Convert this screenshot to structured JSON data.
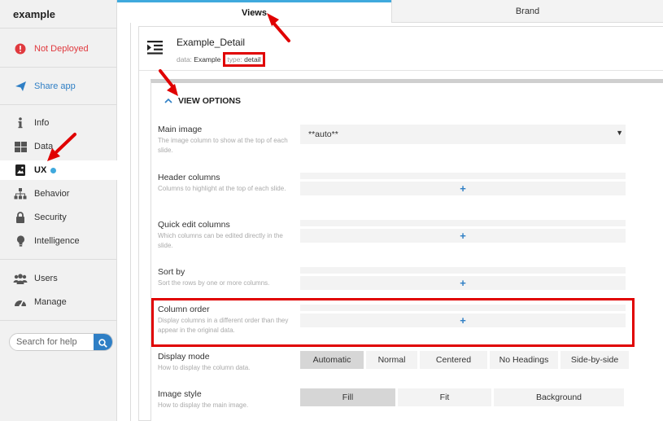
{
  "app": {
    "name": "example"
  },
  "sidebar": {
    "status": {
      "label": "Not Deployed",
      "icon": "alert-circle-icon"
    },
    "share": {
      "label": "Share app",
      "icon": "send-icon"
    },
    "items": [
      {
        "label": "Info",
        "icon": "info-icon"
      },
      {
        "label": "Data",
        "icon": "grid-icon"
      },
      {
        "label": "UX",
        "icon": "ux-icon"
      },
      {
        "label": "Behavior",
        "icon": "sitemap-icon"
      },
      {
        "label": "Security",
        "icon": "lock-icon"
      },
      {
        "label": "Intelligence",
        "icon": "lightbulb-icon"
      }
    ],
    "bottom": [
      {
        "label": "Users",
        "icon": "users-icon"
      },
      {
        "label": "Manage",
        "icon": "gauge-icon"
      }
    ],
    "search": {
      "placeholder": "Search for help"
    }
  },
  "tabs": {
    "views": "Views",
    "brand": "Brand"
  },
  "view": {
    "title": "Example_Detail",
    "data_key": "data:",
    "data_value": "Example",
    "type_key": "type:",
    "type_value": "detail"
  },
  "options": {
    "heading": "VIEW OPTIONS",
    "main_image": {
      "label": "Main image",
      "desc": "The image column to show at the top of each slide.",
      "value": "**auto**"
    },
    "header_columns": {
      "label": "Header columns",
      "desc": "Columns to highlight at the top of each slide.",
      "add": "+"
    },
    "quick_edit": {
      "label": "Quick edit columns",
      "desc": "Which columns can be edited directly in the slide.",
      "add": "+"
    },
    "sort_by": {
      "label": "Sort by",
      "desc": "Sort the rows by one or more columns.",
      "add": "+"
    },
    "column_order": {
      "label": "Column order",
      "desc": "Display columns in a different order than they appear in the original data.",
      "add": "+"
    },
    "display_mode": {
      "label": "Display mode",
      "desc": "How to display the column data.",
      "options": [
        "Automatic",
        "Normal",
        "Centered",
        "No Headings",
        "Side-by-side"
      ],
      "selected": "Automatic"
    },
    "image_style": {
      "label": "Image style",
      "desc": "How to display the main image.",
      "options": [
        "Fill",
        "Fit",
        "Background"
      ],
      "selected": "Fill"
    }
  },
  "colors": {
    "accent": "#2f7fc5",
    "tab_indicator": "#3fa9dd",
    "warning": "#e0393e",
    "annotation": "#e00000"
  }
}
